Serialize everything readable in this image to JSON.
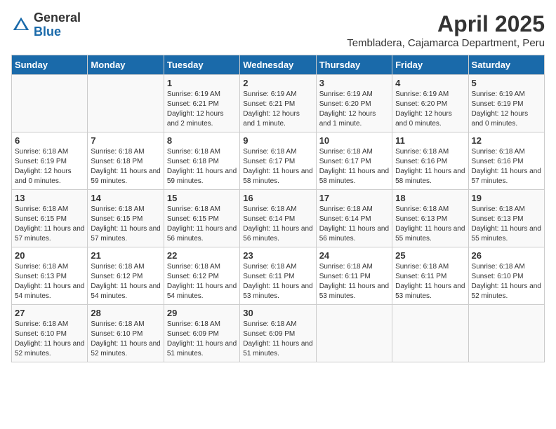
{
  "header": {
    "logo_general": "General",
    "logo_blue": "Blue",
    "title": "April 2025",
    "subtitle": "Tembladera, Cajamarca Department, Peru"
  },
  "days_of_week": [
    "Sunday",
    "Monday",
    "Tuesday",
    "Wednesday",
    "Thursday",
    "Friday",
    "Saturday"
  ],
  "weeks": [
    [
      {
        "day": "",
        "info": ""
      },
      {
        "day": "",
        "info": ""
      },
      {
        "day": "1",
        "info": "Sunrise: 6:19 AM\nSunset: 6:21 PM\nDaylight: 12 hours and 2 minutes."
      },
      {
        "day": "2",
        "info": "Sunrise: 6:19 AM\nSunset: 6:21 PM\nDaylight: 12 hours and 1 minute."
      },
      {
        "day": "3",
        "info": "Sunrise: 6:19 AM\nSunset: 6:20 PM\nDaylight: 12 hours and 1 minute."
      },
      {
        "day": "4",
        "info": "Sunrise: 6:19 AM\nSunset: 6:20 PM\nDaylight: 12 hours and 0 minutes."
      },
      {
        "day": "5",
        "info": "Sunrise: 6:19 AM\nSunset: 6:19 PM\nDaylight: 12 hours and 0 minutes."
      }
    ],
    [
      {
        "day": "6",
        "info": "Sunrise: 6:18 AM\nSunset: 6:19 PM\nDaylight: 12 hours and 0 minutes."
      },
      {
        "day": "7",
        "info": "Sunrise: 6:18 AM\nSunset: 6:18 PM\nDaylight: 11 hours and 59 minutes."
      },
      {
        "day": "8",
        "info": "Sunrise: 6:18 AM\nSunset: 6:18 PM\nDaylight: 11 hours and 59 minutes."
      },
      {
        "day": "9",
        "info": "Sunrise: 6:18 AM\nSunset: 6:17 PM\nDaylight: 11 hours and 58 minutes."
      },
      {
        "day": "10",
        "info": "Sunrise: 6:18 AM\nSunset: 6:17 PM\nDaylight: 11 hours and 58 minutes."
      },
      {
        "day": "11",
        "info": "Sunrise: 6:18 AM\nSunset: 6:16 PM\nDaylight: 11 hours and 58 minutes."
      },
      {
        "day": "12",
        "info": "Sunrise: 6:18 AM\nSunset: 6:16 PM\nDaylight: 11 hours and 57 minutes."
      }
    ],
    [
      {
        "day": "13",
        "info": "Sunrise: 6:18 AM\nSunset: 6:15 PM\nDaylight: 11 hours and 57 minutes."
      },
      {
        "day": "14",
        "info": "Sunrise: 6:18 AM\nSunset: 6:15 PM\nDaylight: 11 hours and 57 minutes."
      },
      {
        "day": "15",
        "info": "Sunrise: 6:18 AM\nSunset: 6:15 PM\nDaylight: 11 hours and 56 minutes."
      },
      {
        "day": "16",
        "info": "Sunrise: 6:18 AM\nSunset: 6:14 PM\nDaylight: 11 hours and 56 minutes."
      },
      {
        "day": "17",
        "info": "Sunrise: 6:18 AM\nSunset: 6:14 PM\nDaylight: 11 hours and 56 minutes."
      },
      {
        "day": "18",
        "info": "Sunrise: 6:18 AM\nSunset: 6:13 PM\nDaylight: 11 hours and 55 minutes."
      },
      {
        "day": "19",
        "info": "Sunrise: 6:18 AM\nSunset: 6:13 PM\nDaylight: 11 hours and 55 minutes."
      }
    ],
    [
      {
        "day": "20",
        "info": "Sunrise: 6:18 AM\nSunset: 6:13 PM\nDaylight: 11 hours and 54 minutes."
      },
      {
        "day": "21",
        "info": "Sunrise: 6:18 AM\nSunset: 6:12 PM\nDaylight: 11 hours and 54 minutes."
      },
      {
        "day": "22",
        "info": "Sunrise: 6:18 AM\nSunset: 6:12 PM\nDaylight: 11 hours and 54 minutes."
      },
      {
        "day": "23",
        "info": "Sunrise: 6:18 AM\nSunset: 6:11 PM\nDaylight: 11 hours and 53 minutes."
      },
      {
        "day": "24",
        "info": "Sunrise: 6:18 AM\nSunset: 6:11 PM\nDaylight: 11 hours and 53 minutes."
      },
      {
        "day": "25",
        "info": "Sunrise: 6:18 AM\nSunset: 6:11 PM\nDaylight: 11 hours and 53 minutes."
      },
      {
        "day": "26",
        "info": "Sunrise: 6:18 AM\nSunset: 6:10 PM\nDaylight: 11 hours and 52 minutes."
      }
    ],
    [
      {
        "day": "27",
        "info": "Sunrise: 6:18 AM\nSunset: 6:10 PM\nDaylight: 11 hours and 52 minutes."
      },
      {
        "day": "28",
        "info": "Sunrise: 6:18 AM\nSunset: 6:10 PM\nDaylight: 11 hours and 52 minutes."
      },
      {
        "day": "29",
        "info": "Sunrise: 6:18 AM\nSunset: 6:09 PM\nDaylight: 11 hours and 51 minutes."
      },
      {
        "day": "30",
        "info": "Sunrise: 6:18 AM\nSunset: 6:09 PM\nDaylight: 11 hours and 51 minutes."
      },
      {
        "day": "",
        "info": ""
      },
      {
        "day": "",
        "info": ""
      },
      {
        "day": "",
        "info": ""
      }
    ]
  ]
}
